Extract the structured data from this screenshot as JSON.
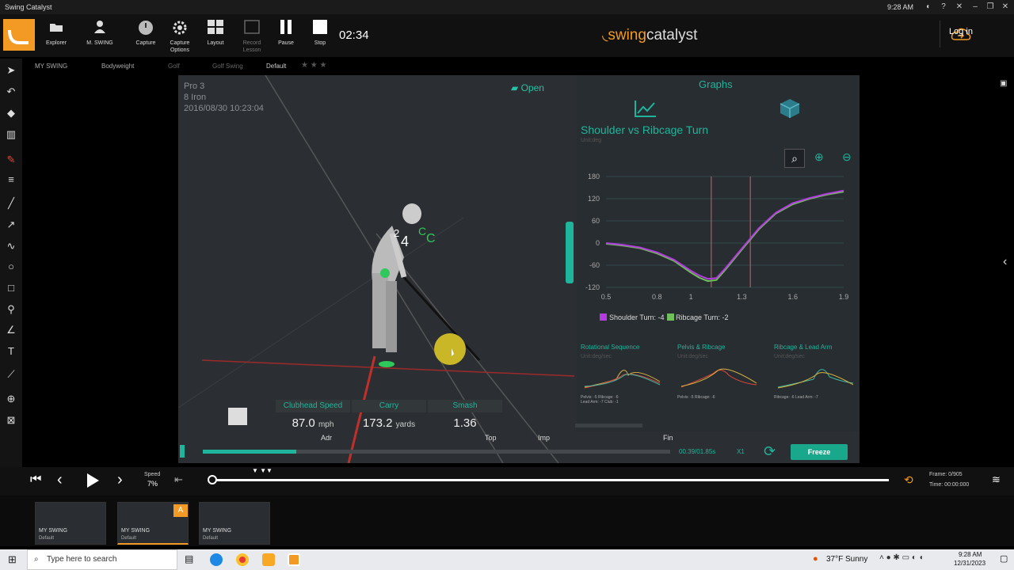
{
  "window": {
    "title": "Swing Catalyst",
    "clock": "9:28 AM"
  },
  "toolbar": {
    "buttons": [
      {
        "label": "Explorer"
      },
      {
        "label": "M. SWING"
      },
      {
        "label": "Capture"
      },
      {
        "label": "Capture Options"
      },
      {
        "label": "Layout"
      },
      {
        "label": "Record Lesson"
      },
      {
        "label": "Pause"
      },
      {
        "label": "Stop"
      }
    ],
    "timer": "02:34",
    "brand_prefix": "swing",
    "brand_suffix": "catalyst",
    "login": "Log in"
  },
  "subbar": {
    "items": [
      "MY SWING",
      "Bodyweight",
      "Golf",
      "Golf Swing",
      "Default"
    ]
  },
  "info": {
    "name": "Pro 3",
    "club": "8 Iron",
    "date": "2016/08/30 10:23:04"
  },
  "open_label": "Open",
  "overlay": {
    "labels": [
      "2",
      "4",
      "C",
      "C"
    ]
  },
  "graphs": {
    "title": "Graphs",
    "chart_title": "Shoulder vs Ribcage Turn",
    "unit": "Unit:deg",
    "legend": [
      "Shoulder Turn: -4",
      "Ribcage Turn: -2"
    ]
  },
  "mini": [
    {
      "title": "Rotational Sequence",
      "unit": "Unit:deg/sec",
      "legend": [
        "Pelvis: -5",
        "Ribcage: -6",
        "Lead Arm: -7",
        "Club: -1"
      ]
    },
    {
      "title": "Pelvis & Ribcage",
      "unit": "Unit:deg/sec",
      "legend": [
        "Pelvis: -5",
        "Ribcage: -6"
      ]
    },
    {
      "title": "Ribcage & Lead Arm",
      "unit": "Unit:deg/sec",
      "legend": [
        "Ribcage: -6",
        "Lead Arm: -7"
      ]
    }
  ],
  "stats": [
    {
      "label": "Clubhead Speed",
      "value": "87.0",
      "unit": "mph"
    },
    {
      "label": "Carry",
      "value": "173.2",
      "unit": "yards"
    },
    {
      "label": "Smash",
      "value": "1.36",
      "unit": ""
    }
  ],
  "timeline": {
    "markers": [
      "Adr",
      "Top",
      "Imp",
      "Fin"
    ],
    "time": "00.39/01.85s",
    "rate": "X1",
    "freeze": "Freeze",
    "progress": 0.2
  },
  "playback": {
    "speed_label": "Speed",
    "speed_value": "7%",
    "frame": "Frame: 0/905",
    "time": "Time: 00:00:000"
  },
  "thumbnails": [
    {
      "name": "MY SWING",
      "sub": "Default"
    },
    {
      "name": "MY SWING",
      "sub": "Default",
      "badge": "A"
    },
    {
      "name": "MY SWING",
      "sub": "Default"
    }
  ],
  "taskbar": {
    "search": "Type here to search",
    "weather": "37°F  Sunny",
    "time": "9:28 AM",
    "date": "12/31/2023"
  },
  "colors": {
    "accent": "#1fb59c",
    "shoulder": "#b43be0",
    "ribcage": "#6fbf5a",
    "brand": "#f39a24"
  },
  "chart_data": {
    "type": "line",
    "title": "Shoulder vs Ribcage Turn",
    "x": [
      0.5,
      0.6,
      0.7,
      0.8,
      0.9,
      1.0,
      1.05,
      1.1,
      1.15,
      1.2,
      1.3,
      1.4,
      1.5,
      1.6,
      1.7,
      1.8,
      1.9
    ],
    "series": [
      {
        "name": "Shoulder Turn",
        "values": [
          0,
          -5,
          -12,
          -25,
          -45,
          -75,
          -88,
          -97,
          -95,
          -70,
          -15,
          40,
          82,
          108,
          122,
          133,
          142
        ]
      },
      {
        "name": "Ribcage Turn",
        "values": [
          -2,
          -7,
          -14,
          -28,
          -48,
          -80,
          -94,
          -103,
          -100,
          -74,
          -18,
          37,
          80,
          105,
          120,
          131,
          139
        ]
      }
    ],
    "xticks": [
      0.5,
      0.8,
      1.0,
      1.3,
      1.6,
      1.9
    ],
    "yticks": [
      180,
      120,
      60,
      0,
      -60,
      -120
    ],
    "xlim": [
      0.5,
      1.9
    ],
    "ylim": [
      -120,
      180
    ],
    "vlines": [
      1.12,
      1.35
    ],
    "grid": true,
    "legend": "bottom-left"
  }
}
